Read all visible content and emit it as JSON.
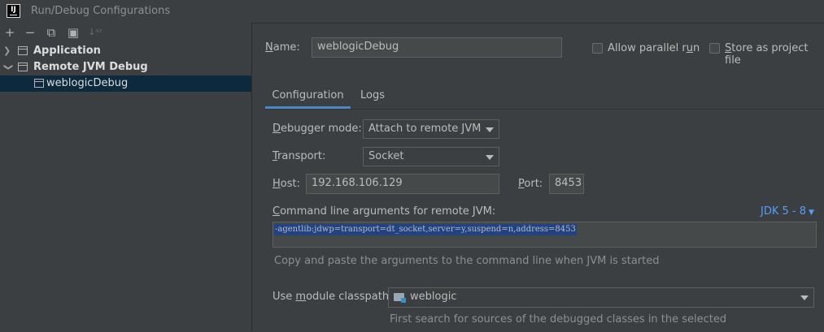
{
  "window": {
    "title": "Run/Debug Configurations",
    "logo_text": "IJ"
  },
  "toolbar": {
    "add": "+",
    "remove": "−",
    "copy": "⧉",
    "folder": "▣",
    "sort": "↓ᵃᶻ"
  },
  "tree": {
    "items": [
      {
        "label": "Application",
        "expanded": false
      },
      {
        "label": "Remote JVM Debug",
        "expanded": true
      },
      {
        "label": "weblogicDebug",
        "selected": true
      }
    ]
  },
  "form": {
    "name_label_prefix": "N",
    "name_label_rest": "ame:",
    "name_value": "weblogicDebug",
    "allow_parallel_prefix": "Allow parallel r",
    "allow_parallel_u": "u",
    "allow_parallel_suffix": "n",
    "store_prefix": "",
    "store_u": "S",
    "store_suffix": "tore as project file",
    "tabs": [
      "Configuration",
      "Logs"
    ],
    "debugger_mode_u": "D",
    "debugger_mode_rest": "ebugger mode:",
    "debugger_mode_value": "Attach to remote JVM",
    "transport_u": "T",
    "transport_rest": "ransport:",
    "transport_value": "Socket",
    "host_u": "H",
    "host_rest": "ost:",
    "host_value": "192.168.106.129",
    "port_u": "P",
    "port_rest": "ort:",
    "port_value": "8453",
    "cmd_label_u": "C",
    "cmd_label_rest": "ommand line arguments for remote JVM:",
    "jdk_link": "JDK 5 - 8",
    "cmd_value": "-agentlib:jdwp=transport=dt_socket,server=y,suspend=n,address=8453",
    "cmd_hint": "Copy and paste the arguments to the command line when JVM is started",
    "module_prefix": "Use ",
    "module_u": "m",
    "module_rest": "odule classpath:",
    "module_value": "weblogic",
    "module_hint": "First search for sources of the debugged classes in the selected"
  },
  "colors": {
    "accent": "#4a88c7",
    "selection": "#0d293e",
    "text_selection": "#214283",
    "link": "#589df6"
  }
}
